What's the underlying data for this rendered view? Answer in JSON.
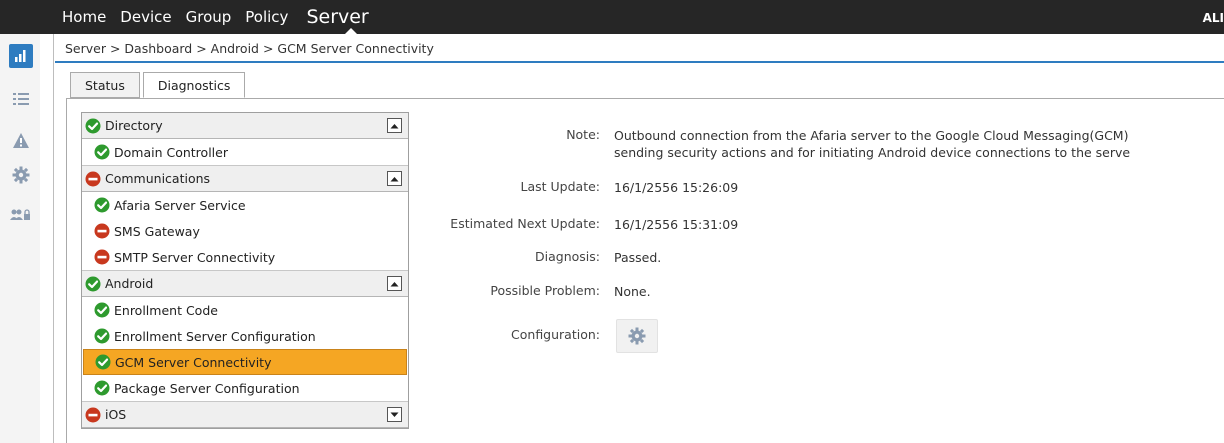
{
  "topnav": {
    "items": [
      "Home",
      "Device",
      "Group",
      "Policy"
    ],
    "active": "Server",
    "user": "ALI"
  },
  "rail": {
    "icons": [
      "dashboard-icon",
      "list-icon",
      "warning-icon",
      "gear-icon",
      "users-lock-icon"
    ],
    "active_color": "#2e7cc0"
  },
  "breadcrumb": "Server > Dashboard > Android > GCM Server Connectivity",
  "tabs": [
    {
      "label": "Status"
    },
    {
      "label": "Diagnostics",
      "active": true
    }
  ],
  "tree": {
    "groups": [
      {
        "label": "Directory",
        "status": "ok",
        "expanded": true,
        "items": [
          {
            "label": "Domain Controller",
            "status": "ok"
          }
        ]
      },
      {
        "label": "Communications",
        "status": "error",
        "expanded": true,
        "items": [
          {
            "label": "Afaria Server Service",
            "status": "ok"
          },
          {
            "label": "SMS Gateway",
            "status": "error"
          },
          {
            "label": "SMTP Server Connectivity",
            "status": "error"
          }
        ]
      },
      {
        "label": "Android",
        "status": "ok",
        "expanded": true,
        "items": [
          {
            "label": "Enrollment Code",
            "status": "ok"
          },
          {
            "label": "Enrollment Server Configuration",
            "status": "ok"
          },
          {
            "label": "GCM Server Connectivity",
            "status": "ok",
            "selected": true
          },
          {
            "label": "Package Server Configuration",
            "status": "ok"
          }
        ]
      },
      {
        "label": "iOS",
        "status": "error",
        "expanded": false,
        "items": []
      }
    ],
    "colors": {
      "ok": "#2e9a2e",
      "error": "#c8381e",
      "selected": "#f5a623"
    }
  },
  "details": {
    "note_label": "Note:",
    "note_line1": "Outbound connection from the Afaria server to the Google Cloud Messaging(GCM)",
    "note_line2": "sending security actions and for initiating Android device connections to the serve",
    "last_update_label": "Last Update:",
    "last_update": "16/1/2556 15:26:09",
    "next_update_label": "Estimated Next Update:",
    "next_update": "16/1/2556 15:31:09",
    "diagnosis_label": "Diagnosis:",
    "diagnosis": "Passed.",
    "problem_label": "Possible Problem:",
    "problem": "None.",
    "config_label": "Configuration:"
  }
}
